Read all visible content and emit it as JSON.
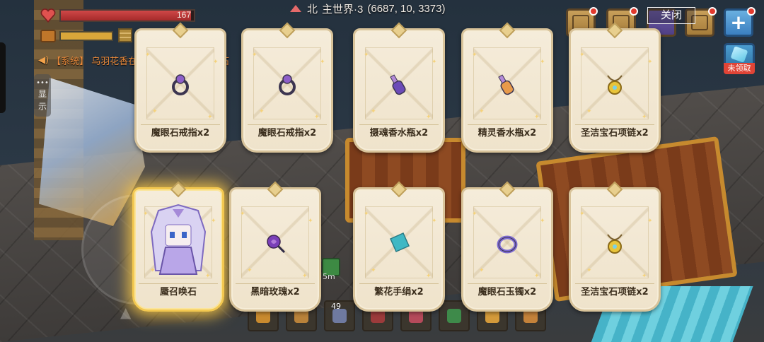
{
  "hud": {
    "hp_value": "167",
    "hp_fraction": 0.98,
    "hunger_fraction": 1.0
  },
  "compass": {
    "direction": "北",
    "world": "主世界·3",
    "coords": "(6687, 10, 3373)"
  },
  "system_message": {
    "tag": "【系统】",
    "text": "乌羽花香在祈福时得到了蜃召唤石"
  },
  "side_tab": {
    "line1": "显",
    "line2": "示"
  },
  "buttons": {
    "close_label": "关闭",
    "unclaimed_label": "未领取"
  },
  "rewards": [
    {
      "label": "魔眼石戒指x2",
      "icon": "ring-icon",
      "color": "#8e5fc9"
    },
    {
      "label": "魔眼石戒指x2",
      "icon": "ring-icon",
      "color": "#8e5fc9"
    },
    {
      "label": "摄魂香水瓶x2",
      "icon": "perfume-bottle-icon",
      "color": "#6c4bb8"
    },
    {
      "label": "精灵香水瓶x2",
      "icon": "perfume-bottle-icon",
      "color": "#e89a4a"
    },
    {
      "label": "圣洁宝石项链x2",
      "icon": "necklace-icon",
      "color": "#e8c43a"
    },
    {
      "label": "蜃召唤石",
      "icon": "summon-stone-figure",
      "color": "#b9a6e8",
      "featured": true
    },
    {
      "label": "黑暗玫瑰x2",
      "icon": "rose-icon",
      "color": "#7a3fb8"
    },
    {
      "label": "繁花手绢x2",
      "icon": "handkerchief-icon",
      "color": "#3fb8c4"
    },
    {
      "label": "魔眼石玉镯x2",
      "icon": "bracelet-icon",
      "color": "#7c6ad1"
    },
    {
      "label": "圣洁宝石项链x2",
      "icon": "necklace-icon",
      "color": "#e8c43a"
    }
  ],
  "hotbar": {
    "slot3_count": "49"
  },
  "buff": {
    "time_text": "5m"
  },
  "colors": {
    "accent_gold": "#f3c850",
    "system_orange": "#e9893a",
    "badge_red": "#e23a2e"
  }
}
